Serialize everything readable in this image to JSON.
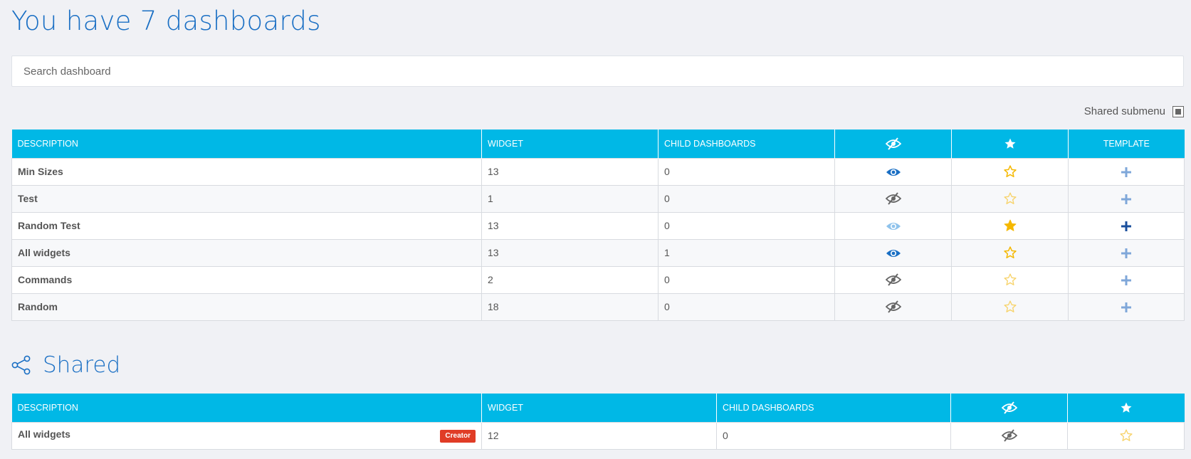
{
  "header": {
    "title": "You have 7 dashboards"
  },
  "search": {
    "placeholder": "Search dashboard",
    "value": ""
  },
  "shared_toggle": {
    "label": "Shared submenu",
    "checked": true
  },
  "dashboards_table": {
    "columns": [
      "DESCRIPTION",
      "WIDGET",
      "CHILD DASHBOARDS",
      "visibility-icon",
      "favorite-icon",
      "TEMPLATE"
    ],
    "rows": [
      {
        "description": "Min Sizes",
        "widget": "13",
        "children": "0",
        "visibility": "visible",
        "favorite": "outline",
        "template": "light"
      },
      {
        "description": "Test",
        "widget": "1",
        "children": "0",
        "visibility": "hidden",
        "favorite": "outline-light",
        "template": "light"
      },
      {
        "description": "Random Test",
        "widget": "13",
        "children": "0",
        "visibility": "visible-light",
        "favorite": "filled",
        "template": "dark"
      },
      {
        "description": "All widgets",
        "widget": "13",
        "children": "1",
        "visibility": "visible",
        "favorite": "outline",
        "template": "light"
      },
      {
        "description": "Commands",
        "widget": "2",
        "children": "0",
        "visibility": "hidden",
        "favorite": "outline-light",
        "template": "light"
      },
      {
        "description": "Random",
        "widget": "18",
        "children": "0",
        "visibility": "hidden",
        "favorite": "outline-light",
        "template": "light"
      }
    ]
  },
  "shared_section": {
    "title": "Shared",
    "columns": [
      "DESCRIPTION",
      "WIDGET",
      "CHILD DASHBOARDS",
      "visibility-icon",
      "favorite-icon"
    ],
    "rows": [
      {
        "description": "All widgets",
        "badge": "Creator",
        "widget": "12",
        "children": "0",
        "visibility": "hidden",
        "favorite": "outline-light"
      }
    ]
  },
  "colors": {
    "accent_blue": "#1a6fc4",
    "header_cyan": "#00b8e6",
    "star_gold": "#f5b800",
    "badge_red": "#e03c26"
  }
}
